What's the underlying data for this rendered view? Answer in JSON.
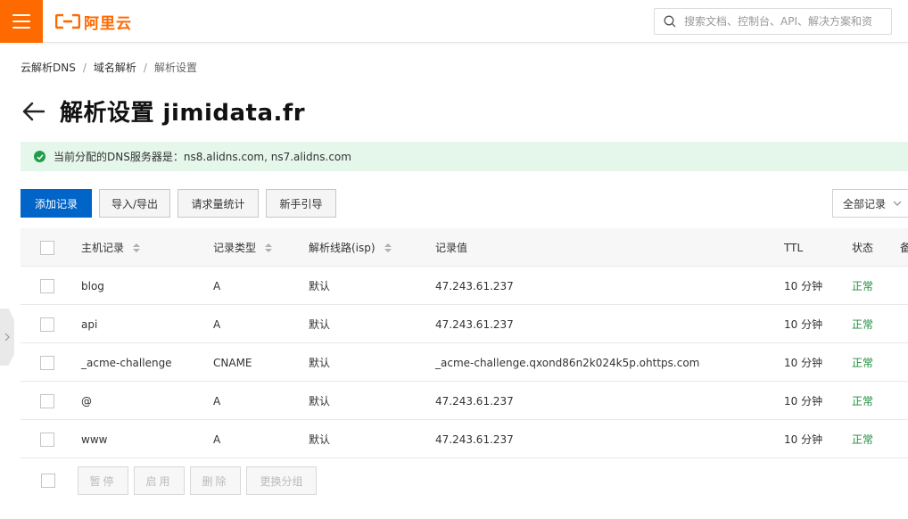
{
  "header": {
    "logo_text": "阿里云",
    "search_placeholder": "搜索文档、控制台、API、解决方案和资"
  },
  "breadcrumb": [
    "云解析DNS",
    "域名解析",
    "解析设置"
  ],
  "page": {
    "title": "解析设置 jimidata.fr"
  },
  "notice": {
    "text": "当前分配的DNS服务器是：ns8.alidns.com, ns7.alidns.com",
    "color": "#1e9e4a"
  },
  "toolbar": {
    "add_record": "添加记录",
    "import_export": "导入/导出",
    "request_stats": "请求量统计",
    "beginner_guide": "新手引导",
    "filter_label": "全部记录"
  },
  "table": {
    "columns": {
      "host": "主机记录",
      "type": "记录类型",
      "line": "解析线路(isp)",
      "value": "记录值",
      "ttl": "TTL",
      "status": "状态",
      "note": "备"
    },
    "rows": [
      {
        "host": "blog",
        "type": "A",
        "line": "默认",
        "value": "47.243.61.237",
        "ttl": "10 分钟",
        "status": "正常"
      },
      {
        "host": "api",
        "type": "A",
        "line": "默认",
        "value": "47.243.61.237",
        "ttl": "10 分钟",
        "status": "正常"
      },
      {
        "host": "_acme-challenge",
        "type": "CNAME",
        "line": "默认",
        "value": "_acme-challenge.qxond86n2k024k5p.ohttps.com",
        "ttl": "10 分钟",
        "status": "正常"
      },
      {
        "host": "@",
        "type": "A",
        "line": "默认",
        "value": "47.243.61.237",
        "ttl": "10 分钟",
        "status": "正常"
      },
      {
        "host": "www",
        "type": "A",
        "line": "默认",
        "value": "47.243.61.237",
        "ttl": "10 分钟",
        "status": "正常"
      }
    ]
  },
  "bulk_actions": {
    "pause": "暂停",
    "enable": "启用",
    "delete": "删除",
    "change_group": "更换分组"
  },
  "colors": {
    "brand": "#ff6a00",
    "primary": "#0064c8",
    "status_ok": "#1e8e3e"
  }
}
